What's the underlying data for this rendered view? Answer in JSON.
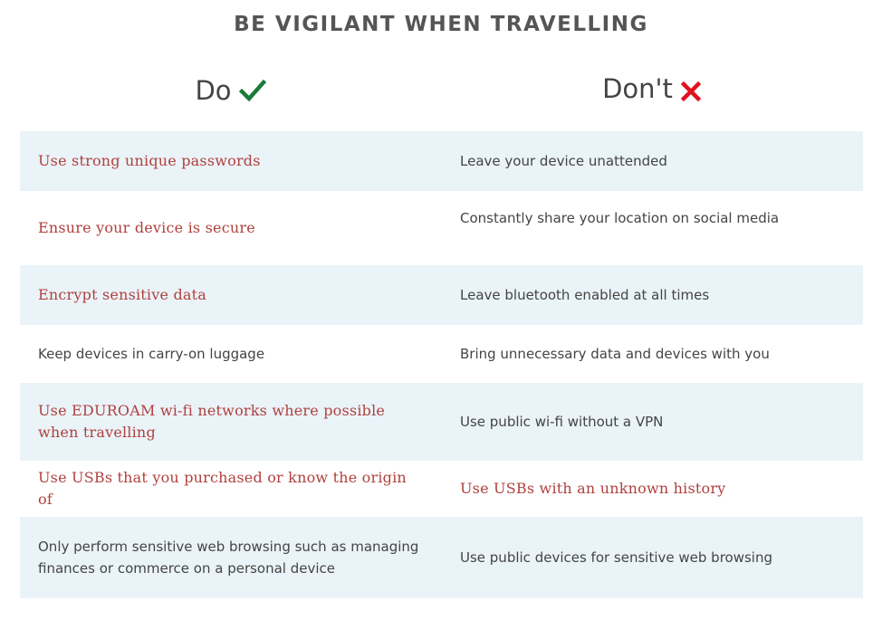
{
  "title": "BE VIGILANT WHEN TRAVELLING",
  "do_header": "Do",
  "dont_header": "Don't",
  "colors": {
    "check": "#1a7a3a",
    "cross": "#e0101e",
    "accent_text": "#b0413e",
    "body_text": "#444444",
    "row_shade": "#eaf3f8"
  },
  "icons": {
    "do": "checkmark-icon",
    "dont": "cross-icon"
  },
  "rows": [
    {
      "do": "Use strong unique passwords",
      "dont": "Leave your device unattended"
    },
    {
      "do": "Ensure your device is secure",
      "dont": "Constantly share your location on social media"
    },
    {
      "do": "Encrypt sensitive data",
      "dont": "Leave bluetooth enabled at all times"
    },
    {
      "do": "Keep devices in carry-on luggage",
      "dont": "Bring unnecessary data and devices with you"
    },
    {
      "do": "Use EDUROAM wi-fi networks where possible when travelling",
      "dont": "Use public wi-fi without a VPN"
    },
    {
      "do": "Use USBs that you purchased or know the origin of",
      "dont": "Use USBs with an unknown history"
    },
    {
      "do": "Only perform sensitive web browsing such as managing finances or commerce on a personal device",
      "dont": "Use public devices for sensitive web browsing"
    }
  ]
}
